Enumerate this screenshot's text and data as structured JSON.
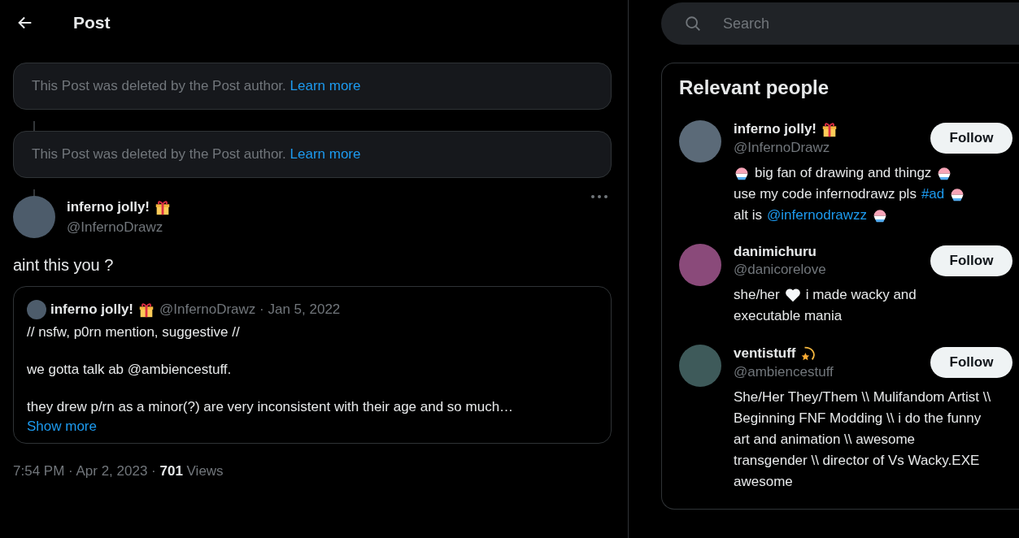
{
  "header": {
    "title": "Post"
  },
  "deleted_posts": [
    {
      "message": "This Post was deleted by the Post author.",
      "link": "Learn more"
    },
    {
      "message": "This Post was deleted by the Post author.",
      "link": "Learn more"
    }
  ],
  "post": {
    "author": {
      "name": "inferno jolly!",
      "badge": {
        "kind": "gift"
      },
      "handle": "@InfernoDrawz"
    },
    "text": "aint this you ?",
    "quote": {
      "name": "inferno jolly!",
      "badge": {
        "kind": "gift"
      },
      "meta": "@InfernoDrawz · Jan 5, 2022",
      "paragraphs": [
        "// nsfw, p0rn mention, suggestive //",
        "we gotta talk ab @ambiencestuff.",
        "they drew p/rn as a minor(?) are very inconsistent with their age and so much…"
      ],
      "show_more": "Show more"
    },
    "stats": "7:54 PM · Apr 2, 2023 · **701** Views"
  },
  "search": {
    "placeholder": "Search"
  },
  "relevant_people": {
    "title": "Relevant people",
    "people": [
      {
        "name": "inferno jolly!",
        "badge": {
          "kind": "gift"
        },
        "handle": "@InfernoDrawz",
        "button": "Follow",
        "bio": [
          [
            {
              "kind": "shaved-ice"
            },
            {
              "kind": "text",
              "text": "big fan of drawing and thingz"
            },
            {
              "kind": "shaved-ice"
            }
          ],
          [
            {
              "kind": "text",
              "text": "use my code infernodrawz pls"
            },
            {
              "kind": "link",
              "text": "#ad"
            },
            {
              "kind": "shaved-ice"
            }
          ],
          [
            {
              "kind": "text",
              "text": "alt is"
            },
            {
              "kind": "link",
              "text": "@infernodrawzz"
            },
            {
              "kind": "shaved-ice"
            }
          ]
        ]
      },
      {
        "name": "danimichuru",
        "handle": "@danicorelove",
        "button": "Follow",
        "bio": [
          [
            {
              "kind": "text",
              "text": "she/her"
            },
            {
              "kind": "heart"
            },
            {
              "kind": "text",
              "text": "i made wacky and"
            }
          ],
          [
            {
              "kind": "text",
              "text": "executable mania"
            }
          ]
        ]
      },
      {
        "name": "ventistuff",
        "badge": {
          "kind": "shooting-star"
        },
        "handle": "@ambiencestuff",
        "button": "Follow",
        "bio": [
          [
            {
              "kind": "text",
              "text": "She/Her They/Them \\\\ Mulifandom Artist \\\\ Beginning FNF Modding \\\\ i do the funny art and animation \\\\ awesome transgender \\\\ director of Vs Wacky.EXE awesome"
            }
          ]
        ]
      }
    ]
  }
}
